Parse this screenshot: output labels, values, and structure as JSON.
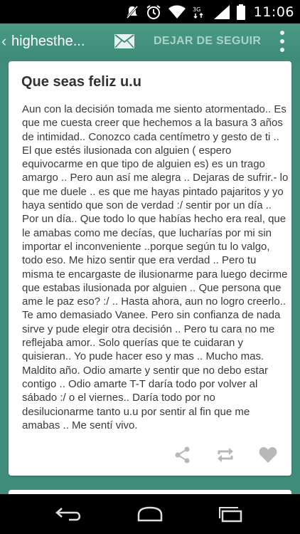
{
  "status_bar": {
    "time": "11:06",
    "icons": [
      "mute-icon",
      "alarm-icon",
      "wifi-icon",
      "3g-icon",
      "signal-icon",
      "battery-icon"
    ]
  },
  "action_bar": {
    "back_glyph": "‹",
    "blog_name": "highesthe...",
    "mail_icon": "mail-icon",
    "unfollow_label": "DEJAR DE SEGUIR",
    "overflow_icon": "overflow-menu-icon"
  },
  "post": {
    "title": "Que seas feliz u.u",
    "body": "Aun con la decisión tomada me siento atormentado.. Es que me cuesta creer que hechemos a la basura 3 años de intimidad.. Conozco cada centímetro y gesto de ti .. El que estés ilusionada con alguien ( espero equivocarme en que tipo de alguien es) es un trago amargo .. Pero aun así me alegra .. Dejaras de sufrir.- lo que me duele .. es que me hayas pintado pajaritos y yo haya sentido que son de verdad :/ sentir por un día .. Por un día.. Que todo lo que habías hecho era real, que le amabas como me decías, que lucharías por mi sin importar el inconveniente ..porque según tu lo valgo, todo eso. Me hizo sentir que era verdad .. Pero tu misma te encargaste de ilusionarme para luego decirme que estabas ilusionada por alguien .. Que persona que ame le paz eso? :/ .. Hasta ahora, aun no logro creerlo.. Te amo demasiado Vanee. Pero sin confianza de nada sirve y pude elegir otra decisión .. Pero tu cara no me reflejaba amor.. Solo querías que te cuidaran y quisieran.. Yo pude hacer eso y mas .. Mucho mas. Maldito año. Odio amarte y sentir que no debo estar contigo .. Odio amarte T-T daría todo por volver al sábado :/ o el viernes.. Daría todo por no desilucionarme tanto u.u por sentir al fin que me amabas .. Me sentí vivo.",
    "actions": [
      "share-icon",
      "reblog-icon",
      "like-heart-icon"
    ]
  },
  "nav_bar": {
    "buttons": [
      "back-icon",
      "home-icon",
      "recent-apps-icon"
    ]
  },
  "colors": {
    "accent": "#3f8c7a",
    "unfollow_text": "#a9d3c7",
    "action_icon": "#b8b8b8"
  }
}
